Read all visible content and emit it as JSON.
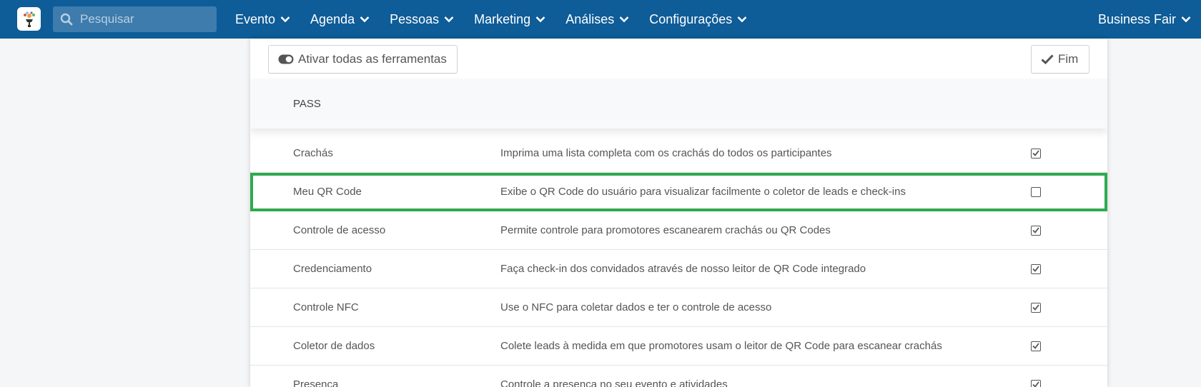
{
  "navbar": {
    "search_placeholder": "Pesquisar",
    "menu": [
      {
        "label": "Evento"
      },
      {
        "label": "Agenda"
      },
      {
        "label": "Pessoas"
      },
      {
        "label": "Marketing"
      },
      {
        "label": "Análises"
      },
      {
        "label": "Configurações"
      }
    ],
    "event_name": "Business Fair"
  },
  "toolbar": {
    "toggle_all_label": "Ativar todas as ferramentas",
    "done_label": "Fim"
  },
  "section": {
    "title": "PASS"
  },
  "tools": [
    {
      "name": "Crachás",
      "description": "Imprima uma lista completa com os crachás do todos os participantes",
      "checked": true
    },
    {
      "name": "Meu QR Code",
      "description": "Exibe o QR Code do usuário para visualizar facilmente o coletor de leads e check-ins",
      "checked": false,
      "highlighted": true
    },
    {
      "name": "Controle de acesso",
      "description": "Permite controle para promotores escanearem crachás ou QR Codes",
      "checked": true
    },
    {
      "name": "Credenciamento",
      "description": "Faça check-in dos convidados através de nosso leitor de QR Code integrado",
      "checked": true
    },
    {
      "name": "Controle NFC",
      "description": "Use o NFC para coletar dados e ter o controle de acesso",
      "checked": true
    },
    {
      "name": "Coletor de dados",
      "description": "Colete leads à medida em que promotores usam o leitor de QR Code para escanear crachás",
      "checked": true
    },
    {
      "name": "Presença",
      "description": "Controle a presença no seu evento e atividades",
      "checked": true
    }
  ],
  "colors": {
    "navbar": "#0e5c98",
    "highlight": "#2faa4e"
  }
}
